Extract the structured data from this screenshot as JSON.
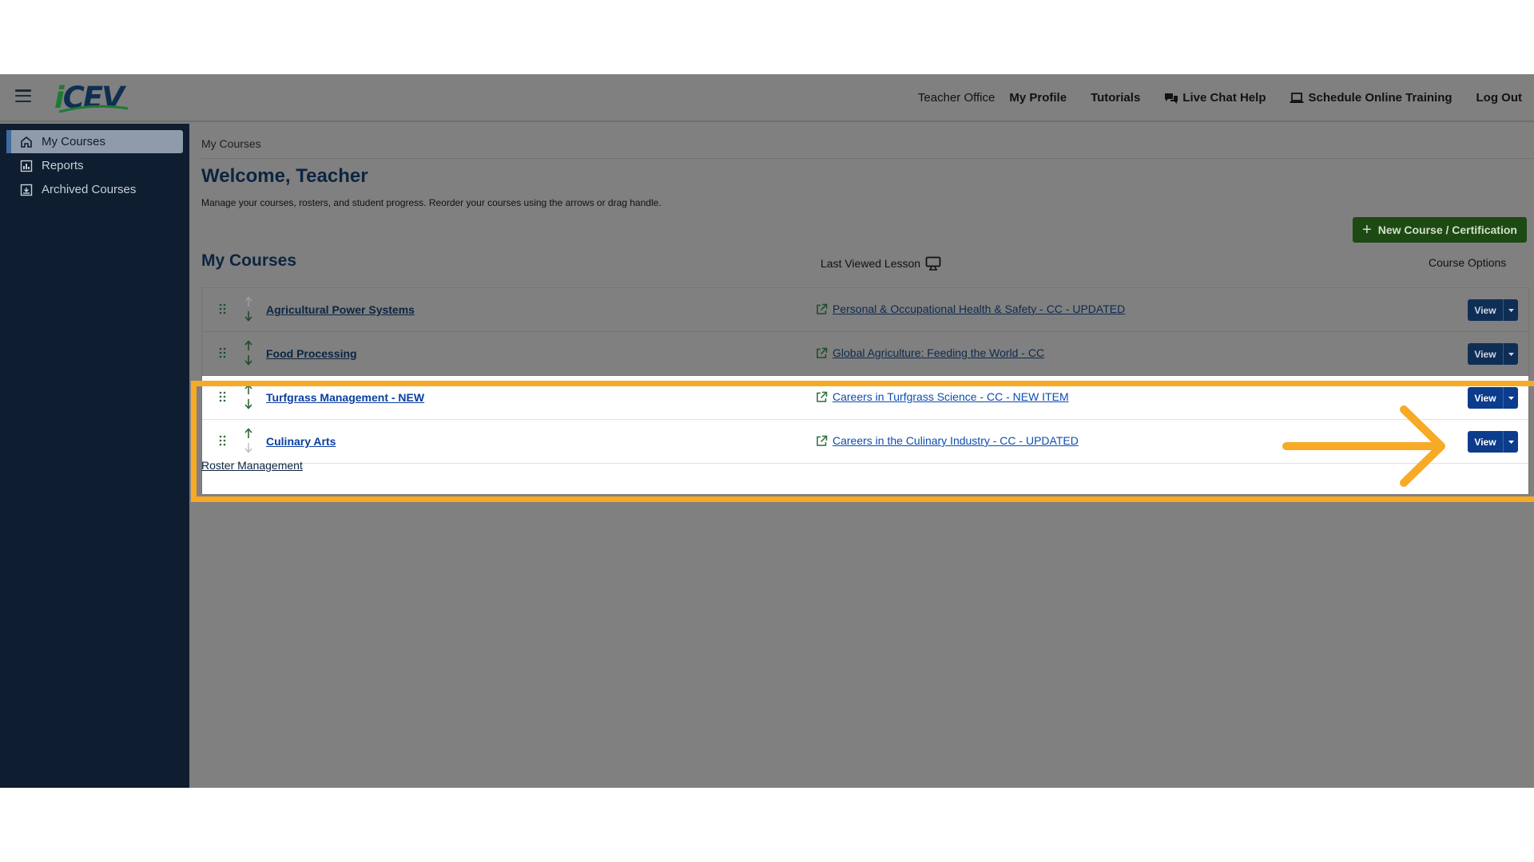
{
  "header": {
    "logo_text": "iCEV",
    "nav": [
      {
        "label": "Teacher Office",
        "icon": ""
      },
      {
        "label": "My Profile",
        "icon": ""
      },
      {
        "label": "Tutorials",
        "icon": ""
      },
      {
        "label": "Live Chat Help",
        "icon": "chat-bubbles-icon"
      },
      {
        "label": "Schedule Online Training",
        "icon": "laptop-icon"
      },
      {
        "label": "Log Out",
        "icon": ""
      }
    ]
  },
  "sidebar": {
    "items": [
      {
        "label": "My Courses",
        "icon": "home-icon",
        "active": true
      },
      {
        "label": "Reports",
        "icon": "report-chart-icon",
        "active": false
      },
      {
        "label": "Archived Courses",
        "icon": "archive-box-icon",
        "active": false
      }
    ]
  },
  "main": {
    "breadcrumb": "My Courses",
    "welcome": "Welcome, Teacher",
    "subtitle": "Manage your courses, rosters, and student progress. Reorder your courses using the arrows or drag handle.",
    "new_course_label": "New Course / Certification",
    "section_title": "My Courses",
    "col_last_viewed": "Last Viewed Lesson",
    "col_options": "Course Options",
    "courses": [
      {
        "name": "Agricultural Power Systems",
        "lesson": "Personal & Occupational Health & Safety - CC - UPDATED",
        "view": "View"
      },
      {
        "name": "Food Processing",
        "lesson": "Global Agriculture: Feeding the World - CC",
        "view": "View"
      },
      {
        "name": "Turfgrass Management - NEW",
        "lesson": "Careers in Turfgrass Science - CC - NEW ITEM",
        "view": "View"
      },
      {
        "name": "Culinary Arts",
        "lesson": "Careers in the Culinary Industry - CC - UPDATED",
        "view": "View"
      }
    ],
    "roster_link": "Roster Management"
  },
  "colors": {
    "overlay_gray": "#808080",
    "sidebar_navy": "#0e1e30",
    "title_navy": "#0c2440",
    "button_blue": "#0c3c8c",
    "new_course_green": "#1d4a13",
    "highlight_orange": "#f7aa25"
  }
}
